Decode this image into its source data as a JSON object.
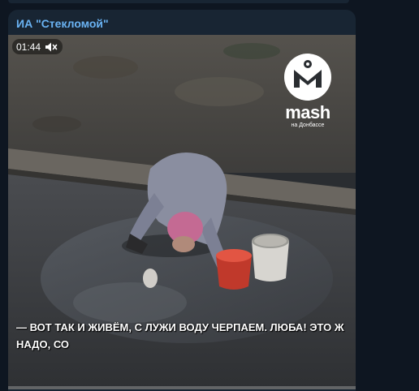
{
  "message": {
    "sender_name": "ИА \"Стекломой\""
  },
  "video": {
    "duration": "01:44",
    "sound_state": "muted",
    "watermark": {
      "brand": "mash",
      "sub": "на Донбассе"
    },
    "subtitle": "— ВОТ ТАК И ЖИВЁМ, С ЛУЖИ ВОДУ ЧЕРПАЕМ. ЛЮБА! ЭТО Ж НАДО, СО",
    "progress": 0
  },
  "icons": {
    "mute": "speaker-muted-icon"
  },
  "colors": {
    "background": "#0e1621",
    "bubble": "#182533",
    "accent": "#6ab3f3"
  }
}
